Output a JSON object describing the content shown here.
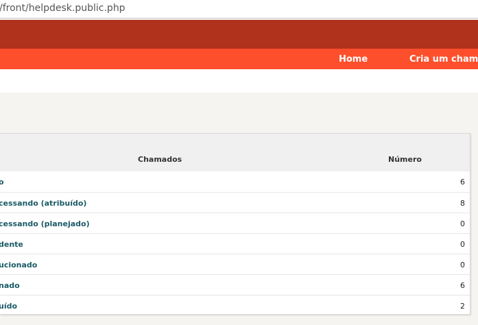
{
  "browser": {
    "url": "/front/helpdesk.public.php"
  },
  "menu": {
    "items": [
      {
        "label": "Home"
      },
      {
        "label": "Cria um chamado"
      }
    ]
  },
  "table": {
    "headers": {
      "chamados": "Chamados",
      "numero": "Número"
    },
    "rows": [
      {
        "label": "o",
        "value": "6"
      },
      {
        "label": "cessando (atribuído)",
        "value": "8"
      },
      {
        "label": "cessando (planejado)",
        "value": "0"
      },
      {
        "label": "dente",
        "value": "0"
      },
      {
        "label": "ucionado",
        "value": "0"
      },
      {
        "label": "nado",
        "value": "6"
      },
      {
        "label": "uído",
        "value": "2"
      }
    ]
  },
  "colors": {
    "top_band": "#b0311c",
    "menu_band": "#fe4f2d",
    "link": "#1a5a66"
  }
}
